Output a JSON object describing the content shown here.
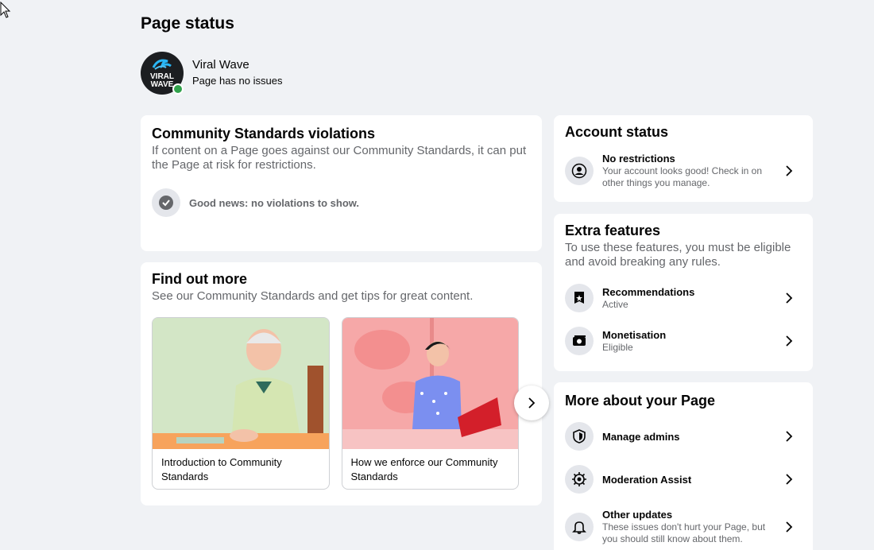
{
  "page": {
    "title": "Page status",
    "name": "Viral Wave",
    "status": "Page has no issues",
    "avatar_text": "VIRAL WAVE"
  },
  "violations": {
    "title": "Community Standards violations",
    "description": "If content on a Page goes against our Community Standards, it can put the Page at risk for restrictions.",
    "good_news": "Good news: no violations to show."
  },
  "find_out_more": {
    "title": "Find out more",
    "description": "See our Community Standards and get tips for great content.",
    "tiles": [
      {
        "caption": "Introduction to Community Standards"
      },
      {
        "caption": "How we enforce our Community Standards"
      }
    ]
  },
  "account_status": {
    "title": "Account status",
    "item": {
      "title": "No restrictions",
      "subtitle": "Your account looks good! Check in on other things you manage."
    }
  },
  "extra_features": {
    "title": "Extra features",
    "description": "To use these features, you must be eligible and avoid breaking any rules.",
    "items": [
      {
        "title": "Recommendations",
        "subtitle": "Active"
      },
      {
        "title": "Monetisation",
        "subtitle": "Eligible"
      }
    ]
  },
  "more_about": {
    "title": "More about your Page",
    "items": [
      {
        "title": "Manage admins"
      },
      {
        "title": "Moderation Assist"
      },
      {
        "title": "Other updates",
        "subtitle": "These issues don't hurt your Page, but you should still know about them."
      }
    ]
  },
  "colors": {
    "background": "#f0f2f5",
    "card": "#ffffff",
    "secondary_text": "#65676b",
    "icon_bg": "#e4e6eb",
    "online": "#31a24c"
  }
}
